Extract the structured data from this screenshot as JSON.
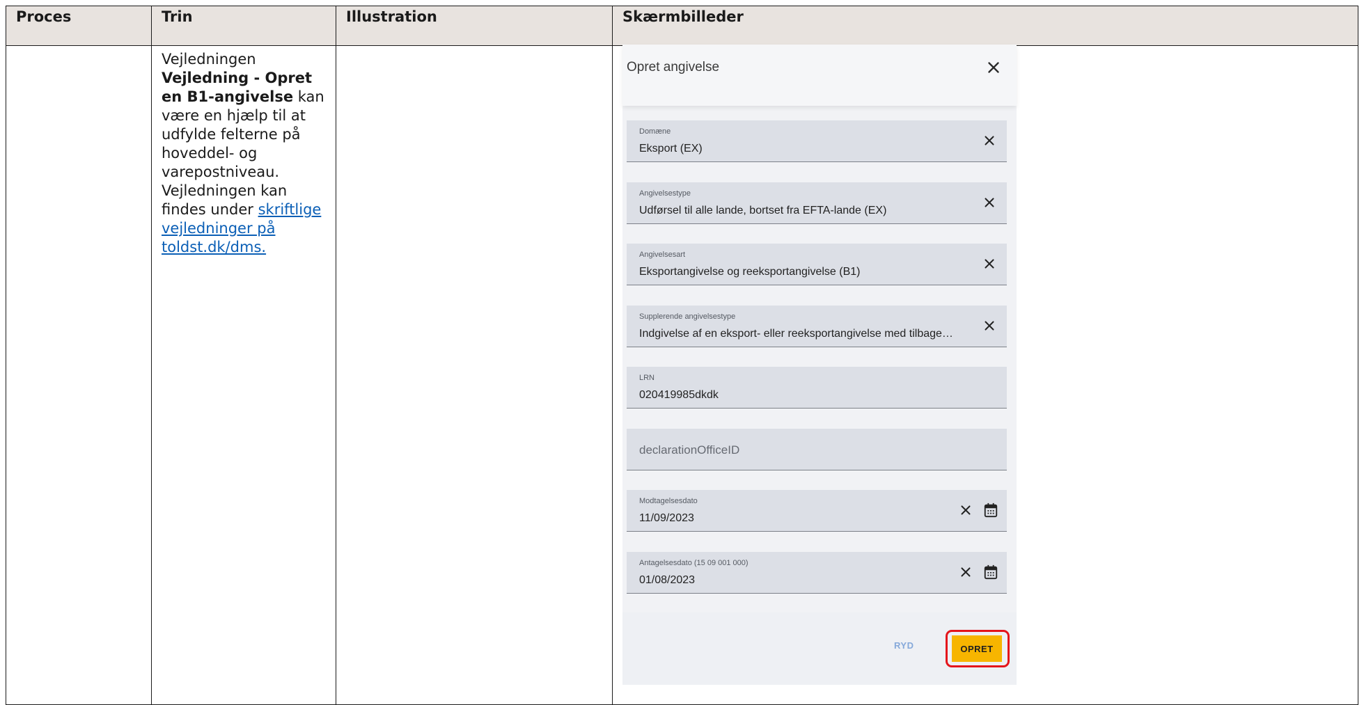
{
  "table": {
    "headers": {
      "proces": "Proces",
      "trin": "Trin",
      "illustration": "Illustration",
      "skaermbilleder": "Skærmbilleder"
    }
  },
  "step": {
    "intro": "Vejledningen",
    "guide_name": "Vejledning - Opret en B1-angivelse",
    "body": " kan være en hjælp til at udfylde felterne på hoveddel- og varepostniveau. Vejledningen kan findes under ",
    "link": "skriftlige vejledninger på toldst.dk/dms."
  },
  "dialog": {
    "title": "Opret angivelse",
    "fields": [
      {
        "label": "Domæne",
        "value": "Eksport (EX)"
      },
      {
        "label": "Angivelsestype",
        "value": "Udførsel til alle lande, bortset fra EFTA-lande (EX)"
      },
      {
        "label": "Angivelsesart",
        "value": "Eksportangivelse og reeksportangivelse (B1)"
      },
      {
        "label": "Supplerende angivelsestype",
        "value": "Indgivelse af en eksport- eller reeksportangivelse med tilbage…"
      },
      {
        "label": "LRN",
        "value": "020419985dkdk"
      },
      {
        "placeholder": "declarationOfficeID"
      },
      {
        "label": "Modtagelsesdato",
        "value": "11/09/2023"
      },
      {
        "label": "Antagelsesdato (15 09 001 000)",
        "value": "01/08/2023"
      }
    ],
    "buttons": {
      "clear": "RYD",
      "create": "OPRET"
    }
  },
  "colors": {
    "header_bg": "#e8e3df",
    "link": "#0b5fb6",
    "field_bg": "#dcdfe6",
    "primary_button": "#f7b500",
    "highlight_ring": "#e4151b",
    "secondary_button_text": "#86a9da"
  }
}
